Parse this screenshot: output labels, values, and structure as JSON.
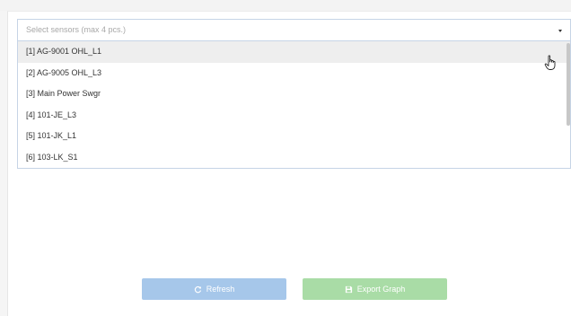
{
  "sensor_select": {
    "placeholder": "Select sensors (max 4 pcs.)",
    "options": [
      {
        "label": "[1] AG-9001 OHL_L1"
      },
      {
        "label": "[2] AG-9005 OHL_L3"
      },
      {
        "label": "[3] Main Power Swgr"
      },
      {
        "label": "[4] 101-JE_L3"
      },
      {
        "label": "[5] 101-JK_L1"
      },
      {
        "label": "[6] 103-LK_S1"
      }
    ]
  },
  "buttons": {
    "refresh_label": "Refresh",
    "export_label": "Export Graph"
  },
  "icons": {
    "refresh": "refresh-icon",
    "export": "save-icon",
    "cursor": "hand-pointer-icon",
    "dropdown": "caret-down-icon"
  },
  "colors": {
    "refresh_button": "#a6c7ea",
    "export_button": "#a9dca6",
    "hover_row": "#eeeeee",
    "select_border": "#c6d4e6"
  }
}
